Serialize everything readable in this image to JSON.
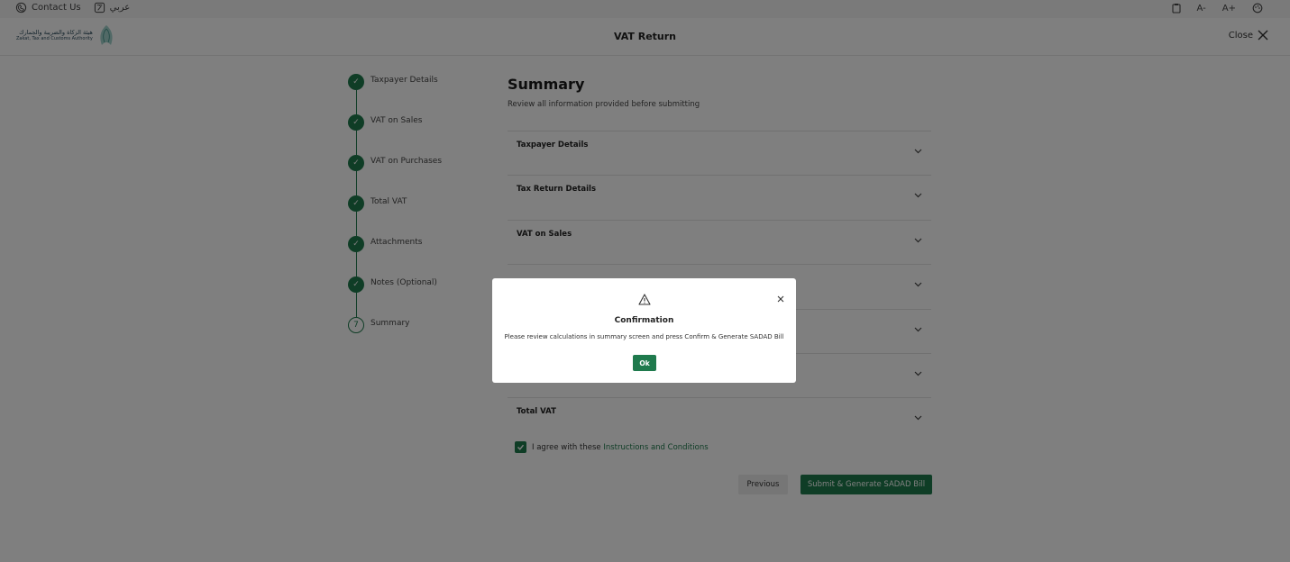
{
  "topbar": {
    "contact_label": "Contact Us",
    "language_label": "عربي",
    "font_decrease_label": "A-",
    "font_increase_label": "A+"
  },
  "header": {
    "logo_arabic": "هيئة الزكاة والضريبة والجمارك",
    "logo_english": "Zakat, Tax and Customs Authority",
    "title": "VAT Return",
    "close_label": "Close"
  },
  "stepper": {
    "steps": [
      {
        "label": "Taxpayer Details",
        "status": "done"
      },
      {
        "label": "VAT on Sales",
        "status": "done"
      },
      {
        "label": "VAT on Purchases",
        "status": "done"
      },
      {
        "label": "Total VAT",
        "status": "done"
      },
      {
        "label": "Attachments",
        "status": "done"
      },
      {
        "label": "Notes (Optional)",
        "status": "done"
      },
      {
        "label": "Summary",
        "status": "current",
        "marker": "7"
      }
    ]
  },
  "summary": {
    "title": "Summary",
    "subtitle": "Review all information provided before submitting",
    "sections": [
      {
        "label": "Taxpayer Details"
      },
      {
        "label": "Tax Return Details"
      },
      {
        "label": "VAT on Sales"
      },
      {
        "label": ""
      },
      {
        "label": ""
      },
      {
        "label": ""
      },
      {
        "label": "Total VAT"
      }
    ],
    "agree_text": "I agree with these ",
    "agree_link": "Instructions and Conditions",
    "previous_label": "Previous",
    "submit_label": "Submit & Generate SADAD Bill"
  },
  "modal": {
    "title": "Confirmation",
    "message": "Please review calculations in summary screen and press Confirm & Generate SADAD Bill",
    "ok_label": "Ok"
  },
  "colors": {
    "brand_green": "#1f7a4d",
    "overlay": "rgba(0,0,0,0.5)"
  }
}
